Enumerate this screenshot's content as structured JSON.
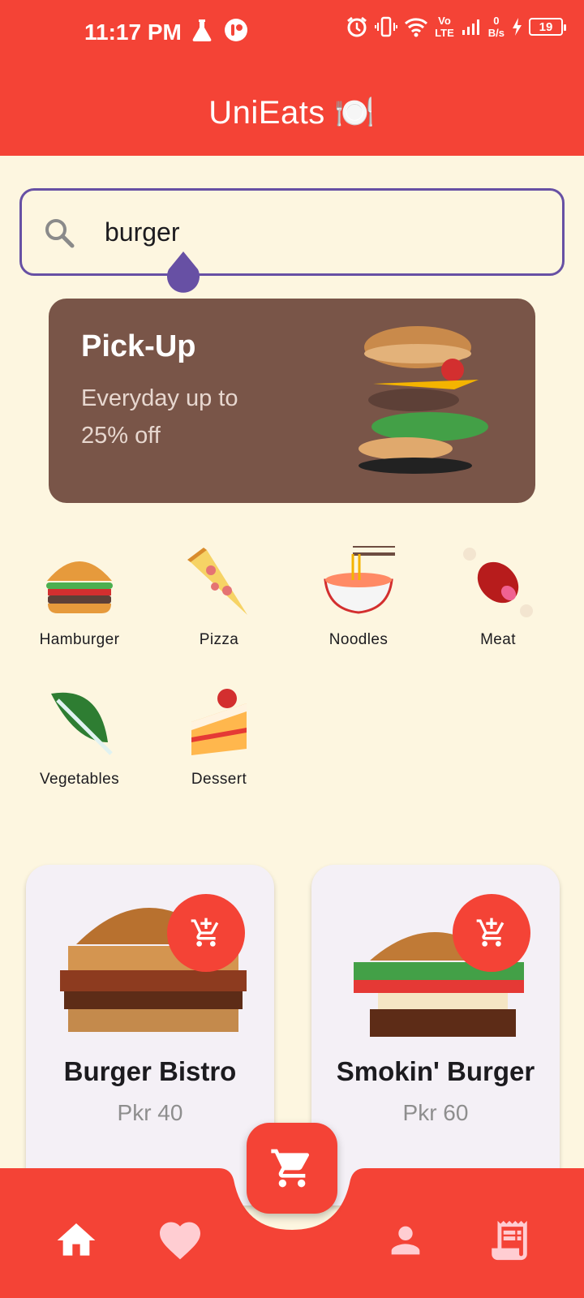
{
  "status_bar": {
    "time": "11:17 PM",
    "net_speed_value": "0",
    "net_speed_unit": "B/s",
    "network_label_top": "Vo",
    "network_label_bottom": "LTE",
    "battery": "19",
    "icons": [
      "flask-icon",
      "app-badge-icon",
      "alarm-icon",
      "vibrate-icon",
      "wifi-icon",
      "signal-icon",
      "charging-icon",
      "battery-icon"
    ]
  },
  "app_bar": {
    "title": "UniEats 🍽️"
  },
  "search": {
    "value": "burger"
  },
  "promo": {
    "title": "Pick-Up",
    "subtitle": "Everyday up to\n 25% off"
  },
  "categories": [
    {
      "label": "Hamburger",
      "emoji": "🍔"
    },
    {
      "label": "Pizza",
      "emoji": "🍕"
    },
    {
      "label": "Noodles",
      "emoji": "🍜"
    },
    {
      "label": "Meat",
      "emoji": "🍖"
    },
    {
      "label": "Vegetables",
      "emoji": "🥬"
    },
    {
      "label": "Dessert",
      "emoji": "🍰"
    }
  ],
  "products": [
    {
      "name": "Burger Bistro",
      "price": "Pkr 40"
    },
    {
      "name": "Smokin' Burger",
      "price": "Pkr 60"
    }
  ],
  "colors": {
    "primary": "#f44336",
    "background": "#fdf6e0",
    "search_border": "#6750a4",
    "promo_bg": "#795548",
    "card_bg": "#f4f0f6"
  },
  "nav": {
    "items": [
      "home-icon",
      "favorite-icon",
      "cart-icon",
      "profile-icon",
      "orders-icon"
    ]
  }
}
